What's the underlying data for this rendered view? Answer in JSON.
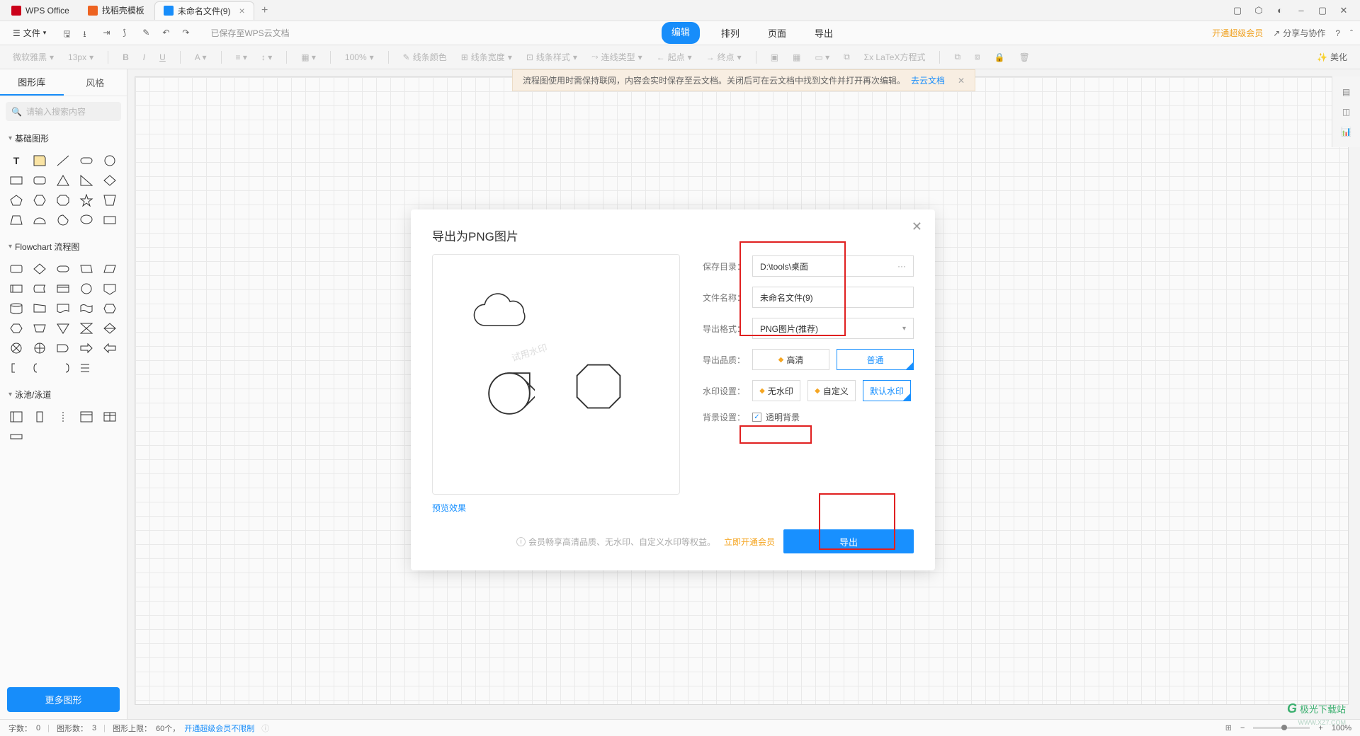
{
  "titlebar": {
    "tabs": [
      {
        "label": "WPS Office",
        "icon": "wps"
      },
      {
        "label": "找稻壳模板",
        "icon": "orange"
      },
      {
        "label": "未命名文件(9)",
        "icon": "blue",
        "active": true
      }
    ]
  },
  "menubar": {
    "file": "文件",
    "saved_hint": "已保存至WPS云文档",
    "tabs": [
      "编辑",
      "排列",
      "页面",
      "导出"
    ],
    "premium": "开通超级会员",
    "share": "分享与协作"
  },
  "toolbar": {
    "font": "微软雅黑",
    "size": "13px",
    "zoom": "100%",
    "line_color": "线条颜色",
    "line_width": "线条宽度",
    "line_style": "线条样式",
    "conn_type": "连线类型",
    "start": "起点",
    "end": "终点",
    "latex": "Σx LaTeX方程式",
    "beautify": "美化"
  },
  "sidebar": {
    "tabs": [
      "图形库",
      "风格"
    ],
    "search_placeholder": "请输入搜索内容",
    "cats": [
      "基础图形",
      "Flowchart 流程图",
      "泳池/泳道"
    ],
    "more": "更多图形"
  },
  "banner": {
    "text": "流程图使用时需保持联网，内容会实时保存至云文档。关闭后可在云文档中找到文件并打开再次编辑。",
    "link": "去云文档"
  },
  "dialog": {
    "title": "导出为PNG图片",
    "labels": {
      "dir": "保存目录：",
      "name": "文件名称：",
      "format": "导出格式：",
      "quality": "导出品质：",
      "watermark": "水印设置：",
      "background": "背景设置："
    },
    "values": {
      "dir": "D:\\tools\\桌面",
      "name": "未命名文件(9)",
      "format": "PNG图片(推荐)"
    },
    "quality_options": [
      "高清",
      "普通"
    ],
    "watermark_options": [
      "无水印",
      "自定义",
      "默认水印"
    ],
    "bg_checkbox": "透明背景",
    "preview_label": "预览效果",
    "preview_wm": "试用水印",
    "footer_hint": "会员畅享高清品质、无水印、自定义水印等权益。",
    "footer_link": "立即开通会员",
    "export_btn": "导出"
  },
  "statusbar": {
    "words_label": "字数：",
    "words": "0",
    "shapes_label": "图形数：",
    "shapes": "3",
    "limit_label": "图形上限：",
    "limit": "60个，",
    "premium_note": "开通超级会员不限制",
    "zoom": "100%"
  },
  "corner": {
    "logo": "极光下载站",
    "sub": "WWW.XZ7.COM"
  }
}
